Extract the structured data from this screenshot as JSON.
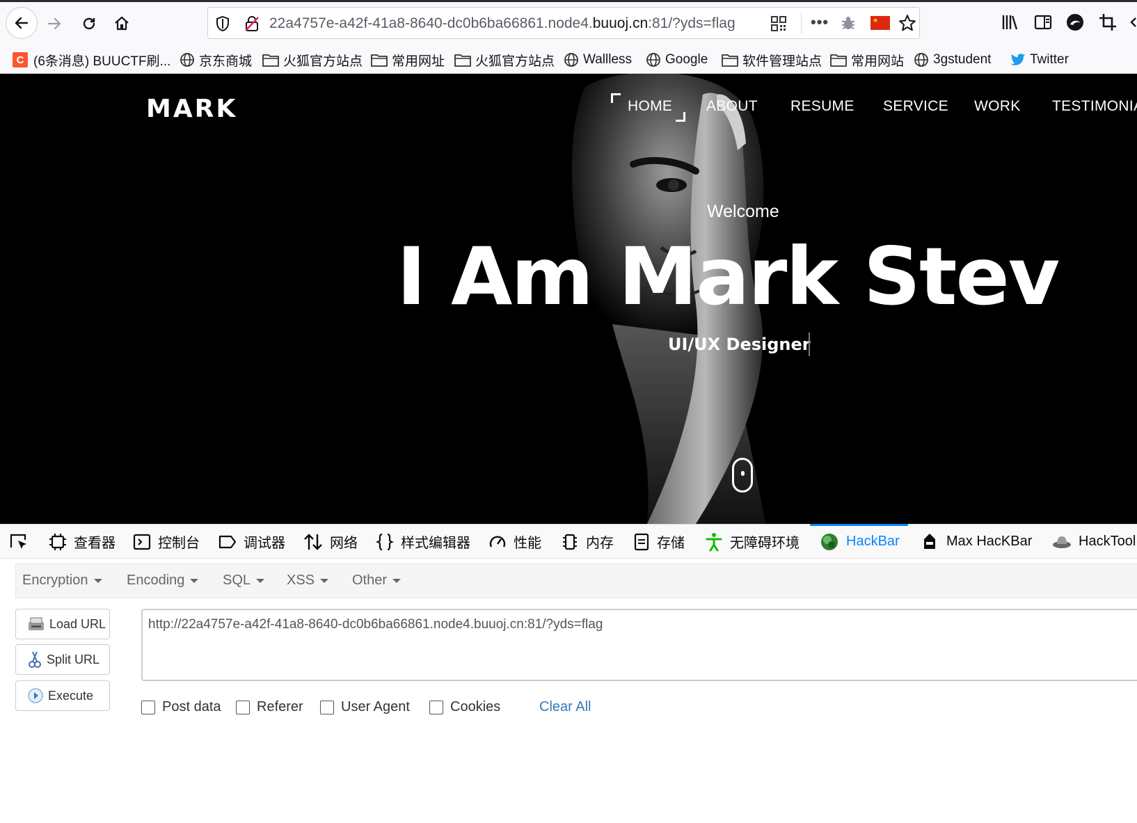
{
  "browser": {
    "url_host_prefix": "22a4757e-a42f-41a8-8640-dc0b6ba66861.node4.",
    "url_host_main": "buuoj.cn",
    "url_rest": ":81/?yds=flag"
  },
  "bookmarks": [
    {
      "label": "(6条消息) BUUCTF刷...",
      "icon": "csdn-icon"
    },
    {
      "label": "京东商城",
      "icon": "globe-icon"
    },
    {
      "label": "火狐官方站点",
      "icon": "folder-icon"
    },
    {
      "label": "常用网址",
      "icon": "folder-icon"
    },
    {
      "label": "火狐官方站点",
      "icon": "folder-icon"
    },
    {
      "label": "Wallless",
      "icon": "globe-icon"
    },
    {
      "label": "Google",
      "icon": "globe-icon"
    },
    {
      "label": "软件管理站点",
      "icon": "folder-icon"
    },
    {
      "label": "常用网站",
      "icon": "folder-icon"
    },
    {
      "label": "3gstudent",
      "icon": "globe-icon"
    },
    {
      "label": "Twitter",
      "icon": "twitter-icon"
    }
  ],
  "site": {
    "logo": "MARK",
    "menu": [
      "HOME",
      "ABOUT",
      "RESUME",
      "SERVICE",
      "WORK",
      "TESTIMONIA"
    ],
    "welcome": "Welcome",
    "headline": "I Am Mark Stev",
    "subtitle": "UI/UX Designer"
  },
  "devtools": {
    "tabs": [
      "查看器",
      "控制台",
      "调试器",
      "网络",
      "样式编辑器",
      "性能",
      "内存",
      "存储",
      "无障碍环境",
      "HackBar",
      "Max HacKBar",
      "HackTool"
    ],
    "selected_tab": "HackBar",
    "accent": "#0a84ff"
  },
  "hackbar": {
    "menus": [
      "Encryption",
      "Encoding",
      "SQL",
      "XSS",
      "Other"
    ],
    "buttons": {
      "load": "Load URL",
      "split": "Split URL",
      "execute": "Execute"
    },
    "url_value": "http://22a4757e-a42f-41a8-8640-dc0b6ba66861.node4.buuoj.cn:81/?yds=flag",
    "checkboxes": [
      "Post data",
      "Referer",
      "User Agent",
      "Cookies"
    ],
    "clear_all": "Clear All",
    "link_color": "#337ab7"
  }
}
